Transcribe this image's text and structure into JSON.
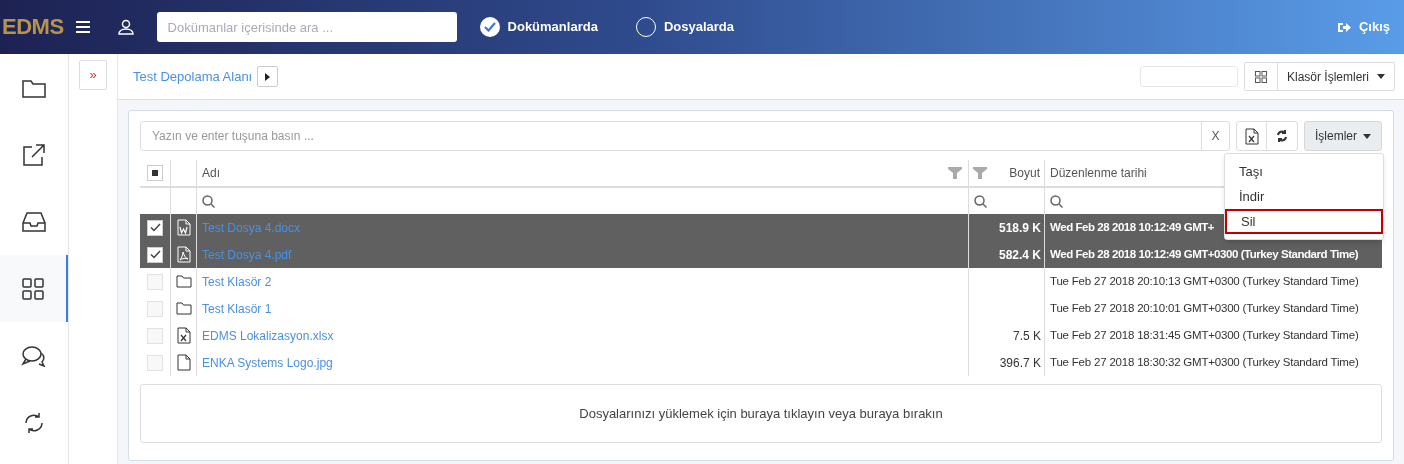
{
  "header": {
    "logo": "EDMS",
    "search": {
      "placeholder": "Dokümanlar içerisinde ara ..."
    },
    "scopes": [
      {
        "label": "Dokümanlarda",
        "selected": true
      },
      {
        "label": "Dosyalarda",
        "selected": false
      }
    ],
    "logout": "Çıkış"
  },
  "sidebar": {
    "items": [
      {
        "kind": "folder",
        "selected": false
      },
      {
        "kind": "share",
        "selected": false
      },
      {
        "kind": "inbox",
        "selected": false
      },
      {
        "kind": "grid",
        "selected": true
      },
      {
        "kind": "chat",
        "selected": false
      },
      {
        "kind": "sync",
        "selected": false
      }
    ]
  },
  "expand_button": "»",
  "breadcrumb": {
    "label": "Test Depolama Alanı"
  },
  "folder_actions": "Klasör İşlemleri",
  "filter": {
    "placeholder": "Yazın ve enter tuşuna basın ...",
    "clear": "X"
  },
  "actions": {
    "label": "İşlemler",
    "menu": [
      {
        "label": "Taşı",
        "selected": false
      },
      {
        "label": "İndir",
        "selected": false
      },
      {
        "label": "Sil",
        "selected": true
      }
    ]
  },
  "table": {
    "select_all_indeterminate": true,
    "columns": [
      "Adı",
      "Boyut",
      "Düzenlenme tarihi"
    ],
    "rows": [
      {
        "kind": "word",
        "name": "Test Dosya 4.docx",
        "size": "518.9 K",
        "modified": "Wed Feb 28 2018 10:12:49 GMT+",
        "selected": true
      },
      {
        "kind": "pdf",
        "name": "Test Dosya 4.pdf",
        "size": "582.4 K",
        "modified": "Wed Feb 28 2018 10:12:49 GMT+0300 (Turkey Standard Time)",
        "selected": true
      },
      {
        "kind": "folder",
        "name": "Test Klasör 2",
        "modified": "Tue Feb 27 2018 20:10:13 GMT+0300 (Turkey Standard Time)",
        "selected": false
      },
      {
        "kind": "folder",
        "name": "Test Klasör 1",
        "modified": "Tue Feb 27 2018 20:10:01 GMT+0300 (Turkey Standard Time)",
        "selected": false
      },
      {
        "kind": "excel",
        "name": "EDMS Lokalizasyon.xlsx",
        "size": "7.5 K",
        "modified": "Tue Feb 27 2018 18:31:45 GMT+0300 (Turkey Standard Time)",
        "selected": false
      },
      {
        "kind": "file",
        "name": "ENKA Systems Logo.jpg",
        "size": "396.7 K",
        "modified": "Tue Feb 27 2018 18:30:32 GMT+0300 (Turkey Standard Time)",
        "selected": false
      }
    ]
  },
  "dropzone": "Dosyalarınızı yüklemek için buraya tıklayın veya buraya bırakın"
}
